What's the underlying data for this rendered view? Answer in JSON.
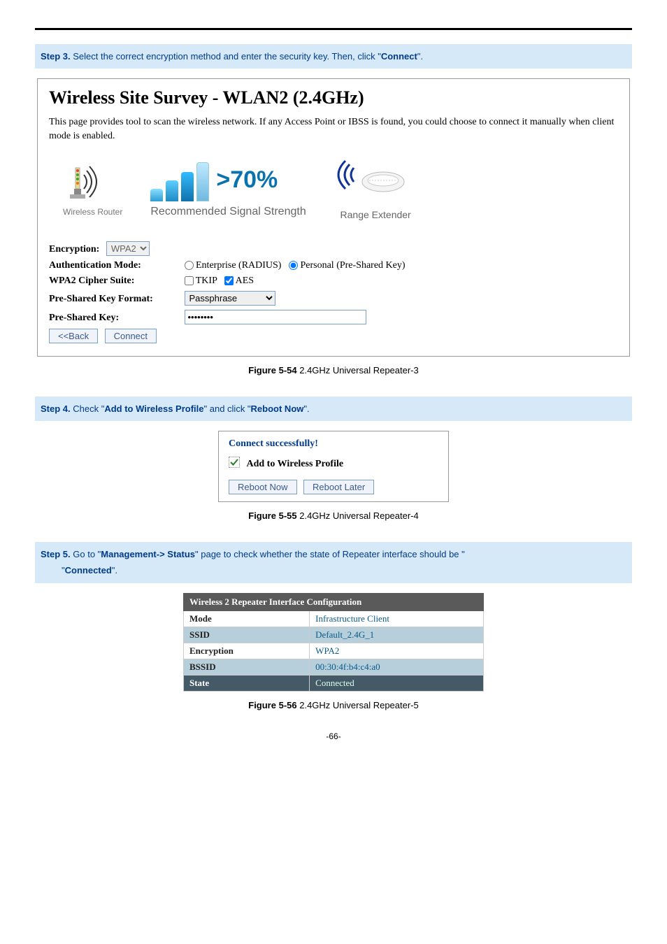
{
  "step3": {
    "label": "Step 3.",
    "text_a": "Select the correct encryption method and enter the security key. Then, click \"",
    "bold": "Connect",
    "text_b": "\"."
  },
  "survey": {
    "title": "Wireless Site Survey - WLAN2 (2.4GHz)",
    "description": "This page provides tool to scan the wireless network. If any Access Point or IBSS is found, you could choose to connect it manually when client mode is enabled.",
    "router_label": "Wireless Router",
    "signal_pct": ">70%",
    "signal_caption": "Recommended Signal Strength",
    "extender_label": "Range Extender",
    "enc_label": "Encryption:",
    "enc_value": "WPA2",
    "auth_label": "Authentication Mode:",
    "auth_opt1": "Enterprise (RADIUS)",
    "auth_opt2": "Personal (Pre-Shared Key)",
    "cipher_label": "WPA2 Cipher Suite:",
    "cipher_tkip": "TKIP",
    "cipher_aes": "AES",
    "psk_format_label": "Pre-Shared Key Format:",
    "psk_format_value": "Passphrase",
    "psk_label": "Pre-Shared Key:",
    "psk_value": "••••••••",
    "back_btn": "<<Back",
    "connect_btn": "Connect"
  },
  "fig54": {
    "label": "Figure 5-54",
    "caption": " 2.4GHz Universal Repeater-3"
  },
  "step4": {
    "label": "Step 4.",
    "text_a": "Check \"",
    "bold1": "Add to Wireless Profile",
    "text_b": "\" and click \"",
    "bold2": "Reboot Now",
    "text_c": "\"."
  },
  "success": {
    "title": "Connect successfully!",
    "add_label": "Add to Wireless Profile",
    "reboot_now": "Reboot Now",
    "reboot_later": "Reboot Later"
  },
  "fig55": {
    "label": "Figure 5-55",
    "caption": " 2.4GHz Universal Repeater-4"
  },
  "step5": {
    "label": "Step 5.",
    "text_a": "Go to \"",
    "bold1": "Management-> Status",
    "text_b": "\" page to check whether the state of Repeater interface should be \"",
    "bold2": "Connected",
    "text_c": "\"."
  },
  "status": {
    "header": "Wireless 2 Repeater Interface Configuration",
    "rows": {
      "mode_k": "Mode",
      "mode_v": "Infrastructure Client",
      "ssid_k": "SSID",
      "ssid_v": "Default_2.4G_1",
      "enc_k": "Encryption",
      "enc_v": "WPA2",
      "bssid_k": "BSSID",
      "bssid_v": "00:30:4f:b4:c4:a0",
      "state_k": "State",
      "state_v": "Connected"
    }
  },
  "fig56": {
    "label": "Figure 5-56",
    "caption": " 2.4GHz Universal Repeater-5"
  },
  "page_number": "-66-"
}
